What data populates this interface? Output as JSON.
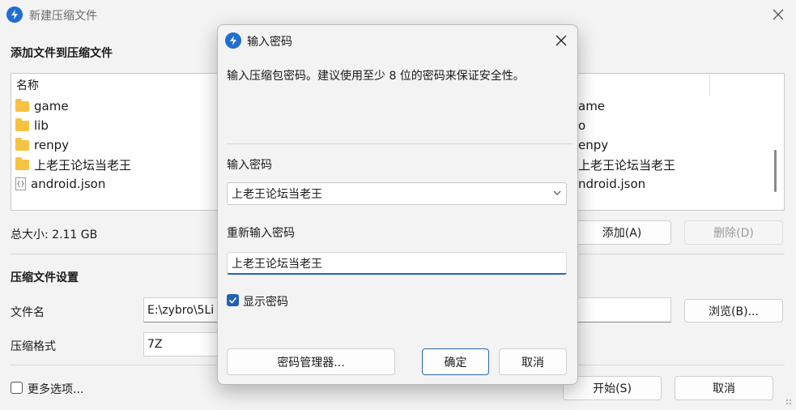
{
  "main": {
    "title": "新建压缩文件",
    "section_add": "添加文件到压缩文件",
    "list_header": "名称",
    "files": [
      {
        "name": "game",
        "type": "folder"
      },
      {
        "name": "lib",
        "type": "folder"
      },
      {
        "name": "renpy",
        "type": "folder"
      },
      {
        "name": "上老王论坛当老王",
        "type": "folder"
      },
      {
        "name": "android.json",
        "type": "file"
      }
    ],
    "files_right_partial": [
      "ame",
      "o",
      "enpy",
      "上老王论坛当老王",
      "ndroid.json"
    ],
    "total_size": "总大小: 2.11 GB",
    "add_button": "添加(A)",
    "remove_button": "删除(D)",
    "section_settings": "压缩文件设置",
    "filename_label": "文件名",
    "filename_value": "E:\\zybro\\5Li",
    "browse_button": "浏览(B)...",
    "format_label": "压缩格式",
    "format_value": "7Z",
    "more_options": "更多选项...",
    "start_button": "开始(S)",
    "cancel_button": "取消"
  },
  "dialog": {
    "title": "输入密码",
    "description": "输入压缩包密码。建议使用至少 8 位的密码来保证安全性。",
    "password_label": "输入密码",
    "password_value": "上老王论坛当老王",
    "reenter_label": "重新输入密码",
    "reenter_value": "上老王论坛当老王",
    "show_password_label": "显示密码",
    "show_password_checked": true,
    "manager_button": "密码管理器...",
    "ok_button": "确定",
    "cancel_button": "取消"
  },
  "colors": {
    "accent": "#2064c2",
    "folder": "#f6c242",
    "window_bg": "#f3f3f3"
  }
}
